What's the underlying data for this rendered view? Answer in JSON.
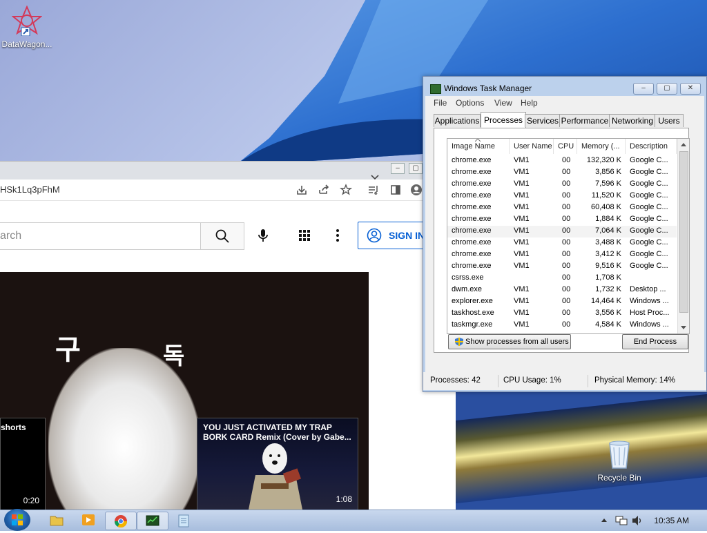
{
  "desktop": {
    "icons": [
      {
        "label": "DataWagon..."
      },
      {
        "label": "Recycle Bin"
      }
    ]
  },
  "chrome": {
    "url_fragment": "HSk1Lq3pFhM",
    "search_placeholder": "arch",
    "signin_label": "SIGN IN",
    "video": {
      "korean_left": "구",
      "korean_right": "독"
    },
    "cards": [
      {
        "title": "shorts",
        "duration": "0:20"
      },
      {
        "title": "YOU JUST ACTIVATED MY TRAP BORK CARD Remix (Cover by Gabe...",
        "duration": "1:08"
      }
    ]
  },
  "taskmanager": {
    "title": "Windows Task Manager",
    "menu": [
      "File",
      "Options",
      "View",
      "Help"
    ],
    "tabs": [
      "Applications",
      "Processes",
      "Services",
      "Performance",
      "Networking",
      "Users"
    ],
    "active_tab": "Processes",
    "columns": [
      "Image Name",
      "User Name",
      "CPU",
      "Memory (...",
      "Description"
    ],
    "rows": [
      {
        "image": "chrome.exe",
        "user": "VM1",
        "cpu": "00",
        "mem": "132,320 K",
        "desc": "Google C..."
      },
      {
        "image": "chrome.exe",
        "user": "VM1",
        "cpu": "00",
        "mem": "3,856 K",
        "desc": "Google C..."
      },
      {
        "image": "chrome.exe",
        "user": "VM1",
        "cpu": "00",
        "mem": "7,596 K",
        "desc": "Google C..."
      },
      {
        "image": "chrome.exe",
        "user": "VM1",
        "cpu": "00",
        "mem": "11,520 K",
        "desc": "Google C..."
      },
      {
        "image": "chrome.exe",
        "user": "VM1",
        "cpu": "00",
        "mem": "60,408 K",
        "desc": "Google C..."
      },
      {
        "image": "chrome.exe",
        "user": "VM1",
        "cpu": "00",
        "mem": "1,884 K",
        "desc": "Google C..."
      },
      {
        "image": "chrome.exe",
        "user": "VM1",
        "cpu": "00",
        "mem": "7,064 K",
        "desc": "Google C..."
      },
      {
        "image": "chrome.exe",
        "user": "VM1",
        "cpu": "00",
        "mem": "3,488 K",
        "desc": "Google C..."
      },
      {
        "image": "chrome.exe",
        "user": "VM1",
        "cpu": "00",
        "mem": "3,412 K",
        "desc": "Google C..."
      },
      {
        "image": "chrome.exe",
        "user": "VM1",
        "cpu": "00",
        "mem": "9,516 K",
        "desc": "Google C..."
      },
      {
        "image": "csrss.exe",
        "user": "",
        "cpu": "00",
        "mem": "1,708 K",
        "desc": ""
      },
      {
        "image": "dwm.exe",
        "user": "VM1",
        "cpu": "00",
        "mem": "1,732 K",
        "desc": "Desktop ..."
      },
      {
        "image": "explorer.exe",
        "user": "VM1",
        "cpu": "00",
        "mem": "14,464 K",
        "desc": "Windows ..."
      },
      {
        "image": "taskhost.exe",
        "user": "VM1",
        "cpu": "00",
        "mem": "3,556 K",
        "desc": "Host Proc..."
      },
      {
        "image": "taskmgr.exe",
        "user": "VM1",
        "cpu": "00",
        "mem": "4,584 K",
        "desc": "Windows ..."
      }
    ],
    "show_all_label": "Show processes from all users",
    "end_process_label": "End Process",
    "status": {
      "processes": "Processes: 42",
      "cpu": "CPU Usage: 1%",
      "memory": "Physical Memory: 14%"
    }
  },
  "taskbar": {
    "clock": "10:35 AM"
  }
}
